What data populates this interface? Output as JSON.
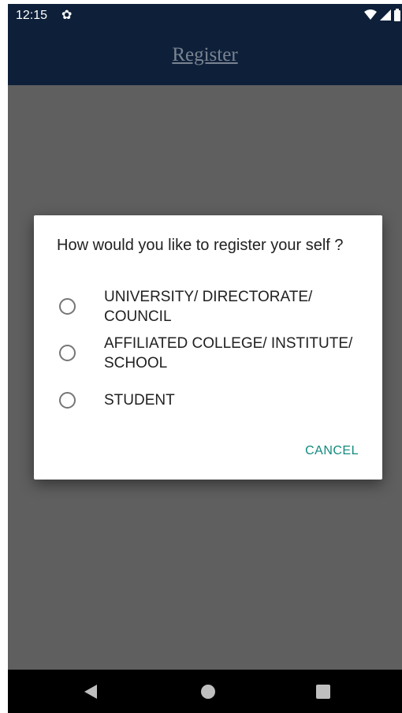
{
  "status_bar": {
    "time": "12:15",
    "icons": [
      "settings-gear-icon",
      "wifi-icon",
      "signal-icon",
      "battery-icon"
    ]
  },
  "app_bar": {
    "title": "Register"
  },
  "dialog": {
    "title": "How would you like to register your self ?",
    "options": [
      {
        "label": "UNIVERSITY/ DIRECTORATE/ COUNCIL",
        "selected": false
      },
      {
        "label": "AFFILIATED COLLEGE/ INSTITUTE/ SCHOOL",
        "selected": false
      },
      {
        "label": "STUDENT",
        "selected": false
      }
    ],
    "cancel_label": "CANCEL"
  },
  "nav_bar": {
    "icons": [
      "back-icon",
      "home-icon",
      "recents-icon"
    ]
  },
  "colors": {
    "app_bar": "#0e2039",
    "scrim": "#5f5f5f",
    "accent": "#108a7d"
  }
}
